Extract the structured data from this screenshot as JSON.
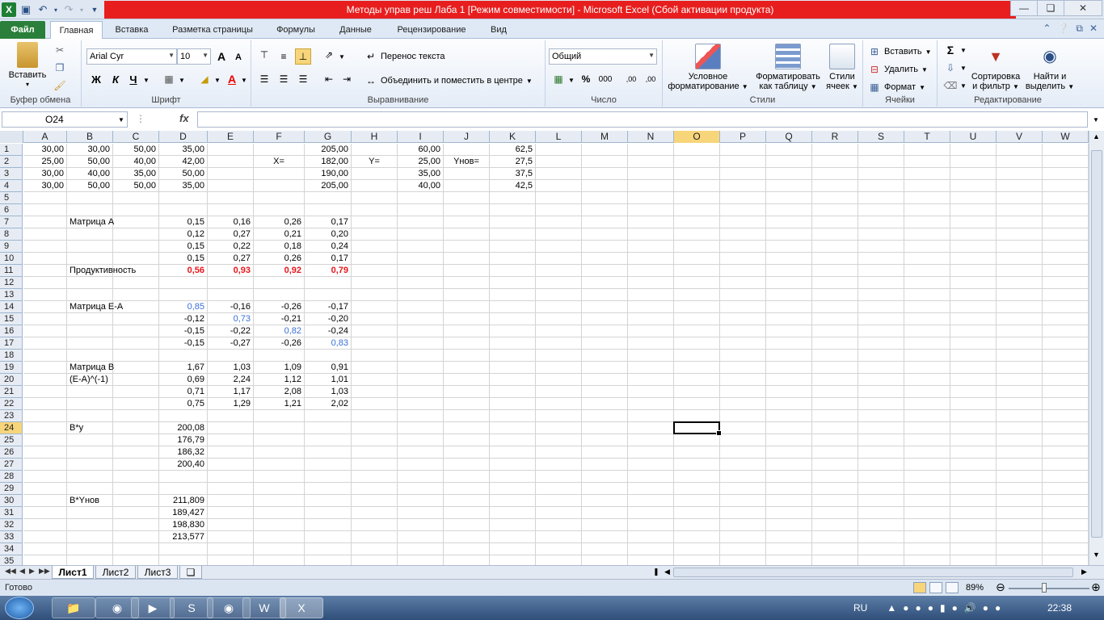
{
  "window": {
    "title": "Методы управ реш Лаба 1  [Режим совместимости]  -  Microsoft Excel (Сбой активации продукта)"
  },
  "tabs": [
    {
      "label": "Файл"
    },
    {
      "label": "Главная"
    },
    {
      "label": "Вставка"
    },
    {
      "label": "Разметка страницы"
    },
    {
      "label": "Формулы"
    },
    {
      "label": "Данные"
    },
    {
      "label": "Рецензирование"
    },
    {
      "label": "Вид"
    }
  ],
  "ribbon": {
    "clipboard": {
      "paste_label": "Вставить",
      "group_label": "Буфер обмена"
    },
    "font": {
      "name": "Arial Cyr",
      "size": "10",
      "group_label": "Шрифт",
      "bold": "Ж",
      "italic": "К",
      "underline": "Ч",
      "grow": "A",
      "shrink": "A"
    },
    "alignment": {
      "wrap_label": "Перенос текста",
      "merge_label": "Объединить и поместить в центре",
      "group_label": "Выравнивание"
    },
    "number": {
      "format": "Общий",
      "group_label": "Число",
      "percent": "%",
      "thousands": "000",
      "inc_decimal": ",00",
      "dec_decimal": ",00"
    },
    "styles": {
      "conditional_label_1": "Условное",
      "conditional_label_2": "форматирование",
      "table_label_1": "Форматировать",
      "table_label_2": "как таблицу",
      "cell_styles_label_1": "Стили",
      "cell_styles_label_2": "ячеек",
      "group_label": "Стили"
    },
    "cells": {
      "insert_label": "Вставить",
      "delete_label": "Удалить",
      "format_label": "Формат",
      "group_label": "Ячейки"
    },
    "editing": {
      "sum": "Σ",
      "sort_label_1": "Сортировка",
      "sort_label_2": "и фильтр",
      "find_label_1": "Найти и",
      "find_label_2": "выделить",
      "group_label": "Редактирование"
    }
  },
  "formula_bar": {
    "name_box": "O24",
    "fx": "fx",
    "formula": ""
  },
  "columns": [
    "A",
    "B",
    "C",
    "D",
    "E",
    "F",
    "G",
    "H",
    "I",
    "J",
    "K",
    "L",
    "M",
    "N",
    "O",
    "P",
    "Q",
    "R",
    "S",
    "T",
    "U",
    "V",
    "W"
  ],
  "active_cell": {
    "col": "O",
    "row": 24
  },
  "cells": [
    {
      "row": 1,
      "col": "A",
      "v": "30,00",
      "a": "r"
    },
    {
      "row": 1,
      "col": "B",
      "v": "30,00",
      "a": "r"
    },
    {
      "row": 1,
      "col": "C",
      "v": "50,00",
      "a": "r"
    },
    {
      "row": 1,
      "col": "D",
      "v": "35,00",
      "a": "r"
    },
    {
      "row": 1,
      "col": "G",
      "v": "205,00",
      "a": "r"
    },
    {
      "row": 1,
      "col": "I",
      "v": "60,00",
      "a": "r"
    },
    {
      "row": 1,
      "col": "K",
      "v": "62,5",
      "a": "r"
    },
    {
      "row": 2,
      "col": "A",
      "v": "25,00",
      "a": "r"
    },
    {
      "row": 2,
      "col": "B",
      "v": "50,00",
      "a": "r"
    },
    {
      "row": 2,
      "col": "C",
      "v": "40,00",
      "a": "r"
    },
    {
      "row": 2,
      "col": "D",
      "v": "42,00",
      "a": "r"
    },
    {
      "row": 2,
      "col": "F",
      "v": "X=",
      "a": "c"
    },
    {
      "row": 2,
      "col": "G",
      "v": "182,00",
      "a": "r"
    },
    {
      "row": 2,
      "col": "H",
      "v": "Y=",
      "a": "c"
    },
    {
      "row": 2,
      "col": "I",
      "v": "25,00",
      "a": "r"
    },
    {
      "row": 2,
      "col": "J",
      "v": "Yнов=",
      "a": "c"
    },
    {
      "row": 2,
      "col": "K",
      "v": "27,5",
      "a": "r"
    },
    {
      "row": 3,
      "col": "A",
      "v": "30,00",
      "a": "r"
    },
    {
      "row": 3,
      "col": "B",
      "v": "40,00",
      "a": "r"
    },
    {
      "row": 3,
      "col": "C",
      "v": "35,00",
      "a": "r"
    },
    {
      "row": 3,
      "col": "D",
      "v": "50,00",
      "a": "r"
    },
    {
      "row": 3,
      "col": "G",
      "v": "190,00",
      "a": "r"
    },
    {
      "row": 3,
      "col": "I",
      "v": "35,00",
      "a": "r"
    },
    {
      "row": 3,
      "col": "K",
      "v": "37,5",
      "a": "r"
    },
    {
      "row": 4,
      "col": "A",
      "v": "30,00",
      "a": "r"
    },
    {
      "row": 4,
      "col": "B",
      "v": "50,00",
      "a": "r"
    },
    {
      "row": 4,
      "col": "C",
      "v": "50,00",
      "a": "r"
    },
    {
      "row": 4,
      "col": "D",
      "v": "35,00",
      "a": "r"
    },
    {
      "row": 4,
      "col": "G",
      "v": "205,00",
      "a": "r"
    },
    {
      "row": 4,
      "col": "I",
      "v": "40,00",
      "a": "r"
    },
    {
      "row": 4,
      "col": "K",
      "v": "42,5",
      "a": "r"
    },
    {
      "row": 7,
      "col": "B",
      "v": "Матрица А",
      "a": "l"
    },
    {
      "row": 7,
      "col": "D",
      "v": "0,15",
      "a": "r"
    },
    {
      "row": 7,
      "col": "E",
      "v": "0,16",
      "a": "r"
    },
    {
      "row": 7,
      "col": "F",
      "v": "0,26",
      "a": "r"
    },
    {
      "row": 7,
      "col": "G",
      "v": "0,17",
      "a": "r"
    },
    {
      "row": 8,
      "col": "D",
      "v": "0,12",
      "a": "r"
    },
    {
      "row": 8,
      "col": "E",
      "v": "0,27",
      "a": "r"
    },
    {
      "row": 8,
      "col": "F",
      "v": "0,21",
      "a": "r"
    },
    {
      "row": 8,
      "col": "G",
      "v": "0,20",
      "a": "r"
    },
    {
      "row": 9,
      "col": "D",
      "v": "0,15",
      "a": "r"
    },
    {
      "row": 9,
      "col": "E",
      "v": "0,22",
      "a": "r"
    },
    {
      "row": 9,
      "col": "F",
      "v": "0,18",
      "a": "r"
    },
    {
      "row": 9,
      "col": "G",
      "v": "0,24",
      "a": "r"
    },
    {
      "row": 10,
      "col": "D",
      "v": "0,15",
      "a": "r"
    },
    {
      "row": 10,
      "col": "E",
      "v": "0,27",
      "a": "r"
    },
    {
      "row": 10,
      "col": "F",
      "v": "0,26",
      "a": "r"
    },
    {
      "row": 10,
      "col": "G",
      "v": "0,17",
      "a": "r"
    },
    {
      "row": 11,
      "col": "B",
      "v": "Продуктивность",
      "a": "l"
    },
    {
      "row": 11,
      "col": "D",
      "v": "0,56",
      "a": "r",
      "s": "red"
    },
    {
      "row": 11,
      "col": "E",
      "v": "0,93",
      "a": "r",
      "s": "red"
    },
    {
      "row": 11,
      "col": "F",
      "v": "0,92",
      "a": "r",
      "s": "red"
    },
    {
      "row": 11,
      "col": "G",
      "v": "0,79",
      "a": "r",
      "s": "red"
    },
    {
      "row": 14,
      "col": "B",
      "v": "Матрица Е-А",
      "a": "l"
    },
    {
      "row": 14,
      "col": "D",
      "v": "0,85",
      "a": "r",
      "s": "blue"
    },
    {
      "row": 14,
      "col": "E",
      "v": "-0,16",
      "a": "r"
    },
    {
      "row": 14,
      "col": "F",
      "v": "-0,26",
      "a": "r"
    },
    {
      "row": 14,
      "col": "G",
      "v": "-0,17",
      "a": "r"
    },
    {
      "row": 15,
      "col": "D",
      "v": "-0,12",
      "a": "r"
    },
    {
      "row": 15,
      "col": "E",
      "v": "0,73",
      "a": "r",
      "s": "blue"
    },
    {
      "row": 15,
      "col": "F",
      "v": "-0,21",
      "a": "r"
    },
    {
      "row": 15,
      "col": "G",
      "v": "-0,20",
      "a": "r"
    },
    {
      "row": 16,
      "col": "D",
      "v": "-0,15",
      "a": "r"
    },
    {
      "row": 16,
      "col": "E",
      "v": "-0,22",
      "a": "r"
    },
    {
      "row": 16,
      "col": "F",
      "v": "0,82",
      "a": "r",
      "s": "blue"
    },
    {
      "row": 16,
      "col": "G",
      "v": "-0,24",
      "a": "r"
    },
    {
      "row": 17,
      "col": "D",
      "v": "-0,15",
      "a": "r"
    },
    {
      "row": 17,
      "col": "E",
      "v": "-0,27",
      "a": "r"
    },
    {
      "row": 17,
      "col": "F",
      "v": "-0,26",
      "a": "r"
    },
    {
      "row": 17,
      "col": "G",
      "v": "0,83",
      "a": "r",
      "s": "blue"
    },
    {
      "row": 19,
      "col": "B",
      "v": "Матрица В",
      "a": "l"
    },
    {
      "row": 19,
      "col": "D",
      "v": "1,67",
      "a": "r"
    },
    {
      "row": 19,
      "col": "E",
      "v": "1,03",
      "a": "r"
    },
    {
      "row": 19,
      "col": "F",
      "v": "1,09",
      "a": "r"
    },
    {
      "row": 19,
      "col": "G",
      "v": "0,91",
      "a": "r"
    },
    {
      "row": 20,
      "col": "B",
      "v": "(E-A)^(-1)",
      "a": "l"
    },
    {
      "row": 20,
      "col": "D",
      "v": "0,69",
      "a": "r"
    },
    {
      "row": 20,
      "col": "E",
      "v": "2,24",
      "a": "r"
    },
    {
      "row": 20,
      "col": "F",
      "v": "1,12",
      "a": "r"
    },
    {
      "row": 20,
      "col": "G",
      "v": "1,01",
      "a": "r"
    },
    {
      "row": 21,
      "col": "D",
      "v": "0,71",
      "a": "r"
    },
    {
      "row": 21,
      "col": "E",
      "v": "1,17",
      "a": "r"
    },
    {
      "row": 21,
      "col": "F",
      "v": "2,08",
      "a": "r"
    },
    {
      "row": 21,
      "col": "G",
      "v": "1,03",
      "a": "r"
    },
    {
      "row": 22,
      "col": "D",
      "v": "0,75",
      "a": "r"
    },
    {
      "row": 22,
      "col": "E",
      "v": "1,29",
      "a": "r"
    },
    {
      "row": 22,
      "col": "F",
      "v": "1,21",
      "a": "r"
    },
    {
      "row": 22,
      "col": "G",
      "v": "2,02",
      "a": "r"
    },
    {
      "row": 24,
      "col": "B",
      "v": "B*y",
      "a": "l"
    },
    {
      "row": 24,
      "col": "D",
      "v": "200,08",
      "a": "r"
    },
    {
      "row": 25,
      "col": "D",
      "v": "176,79",
      "a": "r"
    },
    {
      "row": 26,
      "col": "D",
      "v": "186,32",
      "a": "r"
    },
    {
      "row": 27,
      "col": "D",
      "v": "200,40",
      "a": "r"
    },
    {
      "row": 30,
      "col": "B",
      "v": "B*Yнов",
      "a": "l"
    },
    {
      "row": 30,
      "col": "D",
      "v": "211,809",
      "a": "r"
    },
    {
      "row": 31,
      "col": "D",
      "v": "189,427",
      "a": "r"
    },
    {
      "row": 32,
      "col": "D",
      "v": "198,830",
      "a": "r"
    },
    {
      "row": 33,
      "col": "D",
      "v": "213,577",
      "a": "r"
    }
  ],
  "sheets": [
    {
      "label": "Лист1",
      "active": true
    },
    {
      "label": "Лист2"
    },
    {
      "label": "Лист3"
    }
  ],
  "status": {
    "text": "Готово",
    "zoom": "89%"
  },
  "taskbar": {
    "lang": "RU",
    "time": "22:38"
  },
  "colors": {
    "title_bar": "#e81e1e",
    "file_tab": "#2a7f3a",
    "red_value": "#e8161c",
    "blue_value": "#3a6fd8",
    "selected_header": "#f7d57a"
  }
}
